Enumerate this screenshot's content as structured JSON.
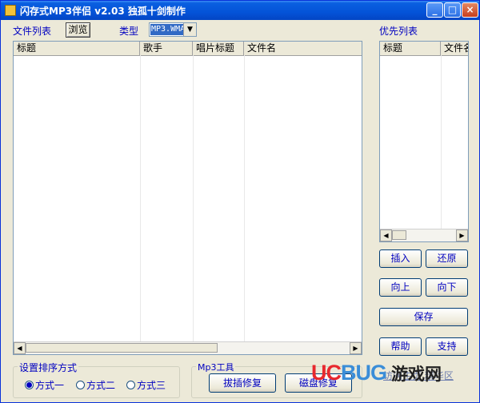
{
  "window": {
    "title": "闪存式MP3伴侣 v2.03 独孤十剑制作"
  },
  "file_list": {
    "label": "文件列表",
    "browse_label": "浏览",
    "type_label": "类型",
    "type_value": "MP3.WMA",
    "columns": [
      "标题",
      "歌手",
      "唱片标题",
      "文件名"
    ]
  },
  "priority_list": {
    "label": "优先列表",
    "columns": [
      "标题",
      "文件名"
    ]
  },
  "buttons": {
    "insert": "插入",
    "restore": "还原",
    "up": "向上",
    "down": "向下",
    "save": "保存",
    "help": "帮助",
    "support": "支持"
  },
  "sort": {
    "title": "设置排序方式",
    "options": [
      "方式一",
      "方式二",
      "方式三"
    ],
    "selected": "方式一"
  },
  "mp3_tools": {
    "title": "Mp3工具",
    "plugin_repair": "拔插修复",
    "disk_repair": "磁盘修复"
  },
  "footer_links": "访问主页  精华区",
  "watermark": {
    "uc": "UC",
    "bug": "BUG",
    "cn": "游戏网"
  }
}
